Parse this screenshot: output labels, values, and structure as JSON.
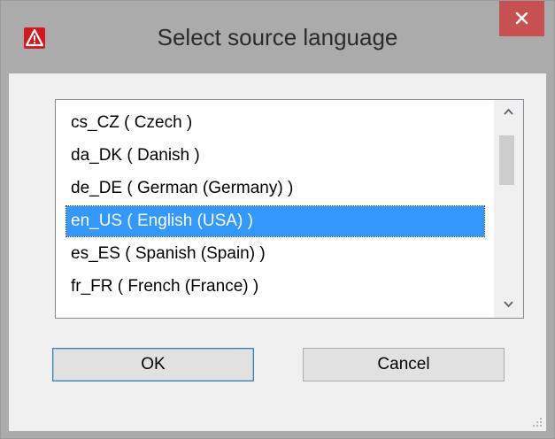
{
  "window": {
    "title": "Select source language",
    "close_symbol": "×",
    "icon": "warning-app-icon",
    "accent_close": "#c75050"
  },
  "language_list": {
    "items": [
      {
        "label": "cs_CZ ( Czech )",
        "selected": false
      },
      {
        "label": "da_DK ( Danish )",
        "selected": false
      },
      {
        "label": "de_DE ( German (Germany) )",
        "selected": false
      },
      {
        "label": "en_US ( English (USA) )",
        "selected": true
      },
      {
        "label": "es_ES ( Spanish (Spain) )",
        "selected": false
      },
      {
        "label": "fr_FR ( French (France) )",
        "selected": false
      }
    ],
    "selection_color": "#3399ff"
  },
  "buttons": {
    "ok_label": "OK",
    "cancel_label": "Cancel"
  }
}
